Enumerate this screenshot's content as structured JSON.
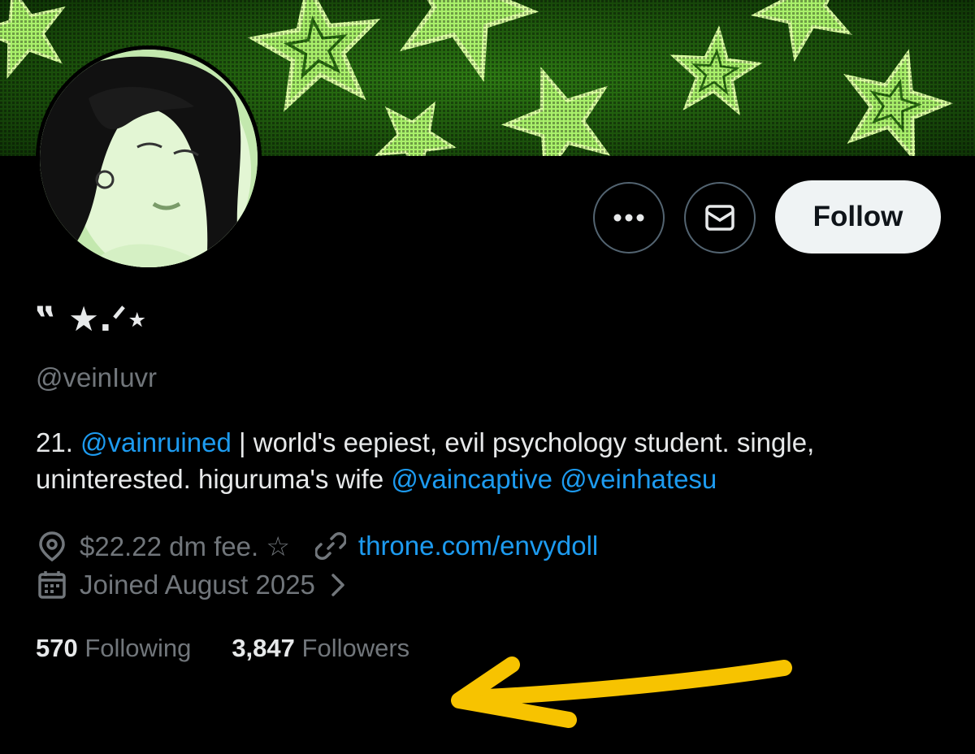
{
  "profile": {
    "display_name": "‟ ★.ᐟ⋆",
    "handle": "@veinIuvr",
    "follow_label": "Follow"
  },
  "bio": {
    "prefix": "21. ",
    "mention1": "@vainruined",
    "middle": " | world's eepiest, evil psychology student. single, uninterested. higuruma's wife ",
    "mention2": "@vaincaptive",
    "space": " ",
    "mention3": "@veinhatesu"
  },
  "meta": {
    "location": "$22.22 dm fee. ☆",
    "link": "throne.com/envydoll",
    "joined": "Joined August 2025"
  },
  "stats": {
    "following_count": "570",
    "following_label": "Following",
    "followers_count": "3,847",
    "followers_label": "Followers"
  },
  "icons": {
    "more": "more-icon",
    "message": "envelope-icon",
    "location": "location-pin-icon",
    "link": "link-icon",
    "calendar": "calendar-icon",
    "chevron": "chevron-right-icon",
    "annotation": "yellow-arrow"
  },
  "colors": {
    "background": "#000000",
    "accent": "#1d9bf0",
    "secondary_text": "#71767b",
    "primary_text": "#e7e9ea",
    "follow_bg": "#eff3f4",
    "banner_green": "#7fdc4a",
    "arrow_yellow": "#f7c300"
  }
}
